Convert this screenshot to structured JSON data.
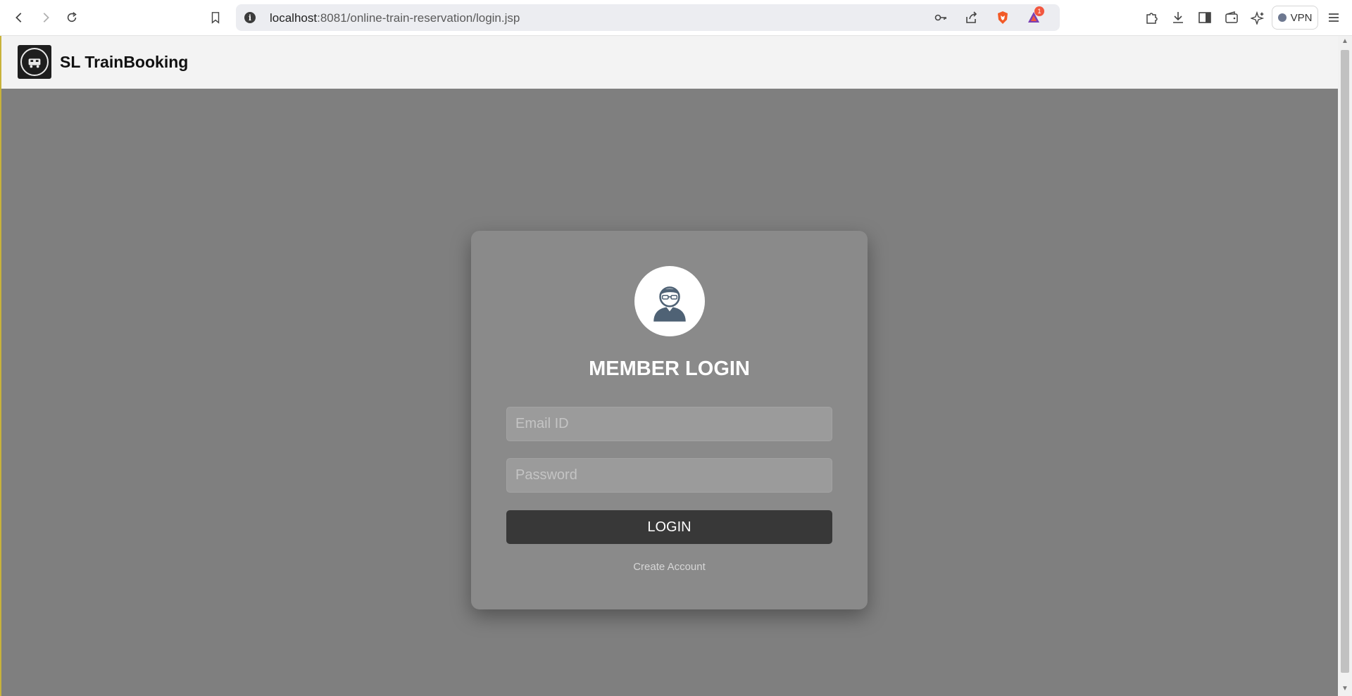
{
  "browser": {
    "url_host": "localhost",
    "url_path": ":8081/online-train-reservation/login.jsp",
    "info_icon_glyph": "i",
    "vpn_label": "VPN",
    "notification_count": "1",
    "icons": [
      "back-icon",
      "forward-icon",
      "reload-icon",
      "bookmark-icon",
      "key-icon",
      "share-icon",
      "brave-shield-icon",
      "brave-rewards-icon",
      "extensions-icon",
      "downloads-icon",
      "sidebar-icon",
      "wallet-icon",
      "leo-ai-icon",
      "menu-icon"
    ]
  },
  "site": {
    "brand": "SL TrainBooking"
  },
  "login": {
    "title": "MEMBER LOGIN",
    "email_placeholder": "Email ID",
    "email_value": "",
    "password_placeholder": "Password",
    "password_value": "",
    "button_label": "LOGIN",
    "create_account_label": "Create Account"
  },
  "colors": {
    "page_background": "#7f7f7f",
    "card_background": "#8a8a8a",
    "button_background": "#383838",
    "header_background": "#f3f3f3"
  }
}
